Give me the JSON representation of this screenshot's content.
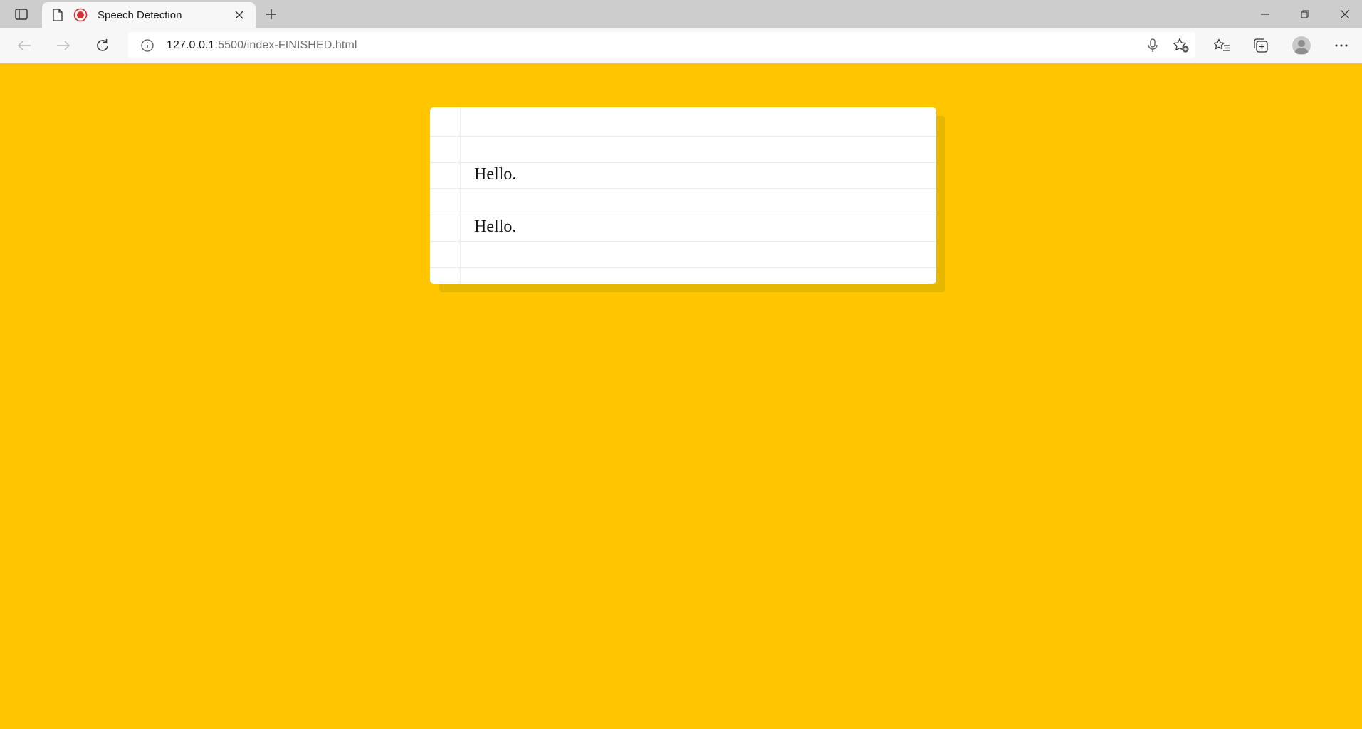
{
  "browser": {
    "tab": {
      "title": "Speech Detection"
    },
    "address_bar": {
      "url_host": "127.0.0.1",
      "url_path": ":5500/index-FINISHED.html"
    },
    "colors": {
      "tabstrip": "#cdcdcd",
      "toolbar": "#f7f7f7",
      "recording_dot": "#d13438"
    }
  },
  "page": {
    "background_color": "#ffc600",
    "transcripts": [
      "Hello.",
      "Hello."
    ]
  }
}
